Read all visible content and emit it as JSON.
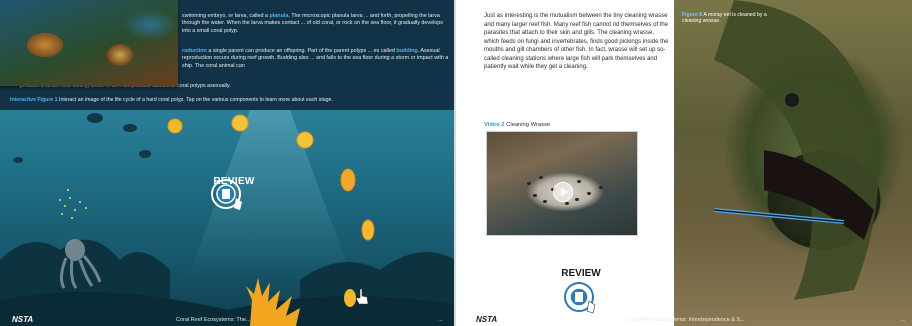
{
  "left_page": {
    "paragraph_1_pre": "swimming embryo, or larva, called a ",
    "planula": "planula",
    "paragraph_1_post": ". The microscopic planula larva ... and forth, propelling the larva through the water. When the larva makes contact ... of old coral, or rock on the sea floor, it gradually develops into a small coral polyp.",
    "reproduction_term": "roduction",
    "paragraph_2_a": " a single parent can produce an offspring. Part of the parent polyps ... es called ",
    "budding": "budding",
    "paragraph_2_b": ". Asexual reproduction occurs during reef growth. Budding also ... and falls to the sea floor during a storm or impact with a ship. The coral animal can",
    "paragraph_3": "produce a whole new colony, which in turn will produce additional coral polyps asexually.",
    "interactive_label": "Interactive Figure 1",
    "interactive_text": " Interact an image of the life cycle of a hard coral polyp. Tap on the various components to learn more about each stage.",
    "review_label": "REVIEW",
    "footer": {
      "logo": "NSTA",
      "title": "Coral Reef Ecosystems: The...",
      "page": "..."
    }
  },
  "right_page": {
    "paragraph": "Just as interesting is the mutualism between the tiny cleaning wrasse and many larger reef fish. Many reef fish cannot rid themselves of the parasites that attach to their skin and gills. The cleaning wrasse, which feeds on fungi and invertebrates, finds good pickings inside the mouths and gill chambers of other fish. In fact, wrasse will set up so-called cleaning stations where large fish will park themselves and patiently wait while they get a cleaning.",
    "video_label": "Video 2",
    "video_title": " Cleaning Wrasse",
    "review_label": "REVIEW",
    "figure_label": "Figure 8",
    "figure_caption": " A moray eel is cleaned by a cleaning wrasse.",
    "footer": {
      "logo": "NSTA",
      "title": "Coral Reef Ecosystems: Interdependence & S...",
      "page": "..."
    }
  },
  "colors": {
    "accent": "#4fb3e8",
    "water_top": "#2a7f98",
    "water_bottom": "#0f3f4f",
    "page_dark": "#123347"
  },
  "icons": [
    "review-book-icon",
    "hand-pointer-icon",
    "play-icon",
    "sun-coin-icon",
    "fish-icon",
    "octopus-icon",
    "coral-icon"
  ]
}
